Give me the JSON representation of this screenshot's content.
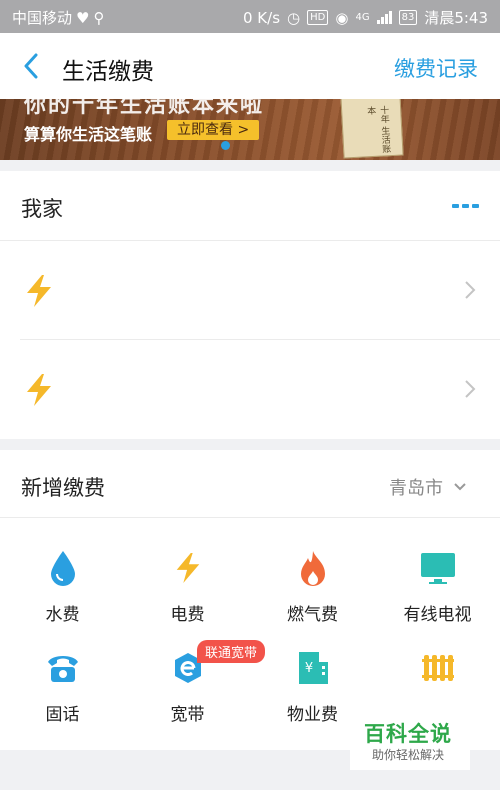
{
  "status_bar": {
    "carrier": "中国移动",
    "speed": "0 K/s",
    "hd": "HD",
    "network": "4G",
    "battery": "83",
    "time": "清晨5:43"
  },
  "nav": {
    "title": "生活缴费",
    "right_link": "缴费记录"
  },
  "banner": {
    "headline": "你的十年生活账本来啦",
    "subtitle": "算算你生活这笔账",
    "button": "立即查看 >",
    "book_text": "十年 生活账本"
  },
  "my_home": {
    "title": "我家",
    "rows": [
      {
        "icon": "lightning-icon"
      },
      {
        "icon": "lightning-icon"
      }
    ]
  },
  "new_payment": {
    "title": "新增缴费",
    "city": "青岛市",
    "items": [
      {
        "label": "水费",
        "icon": "water-drop-icon"
      },
      {
        "label": "电费",
        "icon": "lightning-icon"
      },
      {
        "label": "燃气费",
        "icon": "flame-icon"
      },
      {
        "label": "有线电视",
        "icon": "tv-icon"
      },
      {
        "label": "固话",
        "icon": "telephone-icon"
      },
      {
        "label": "宽带",
        "icon": "broadband-icon"
      },
      {
        "label": "物业费",
        "icon": "building-icon"
      },
      {
        "label": "",
        "icon": "radiator-icon"
      }
    ],
    "broadband_tag": "联通宽带"
  },
  "watermark": {
    "title": "百科全说",
    "subtitle": "助你轻松解决"
  },
  "colors": {
    "accent": "#2a9fe0",
    "bolt": "#f5b82a",
    "gas": "#f06a3a",
    "tv": "#2bbdb4",
    "tag": "#f2534a"
  }
}
